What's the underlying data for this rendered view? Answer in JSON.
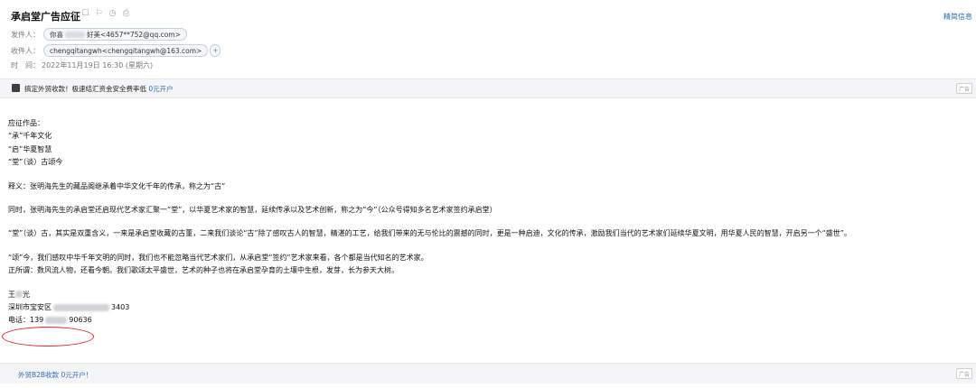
{
  "header": {
    "subject": "承启堂广告应征",
    "top_right_link": "精简信息",
    "sender_label": "发件人：",
    "sender_name_prefix": "你喜",
    "sender_name_suffix": "好美",
    "sender_email": "<4657**752@qq.com>",
    "recipient_label": "收件人：",
    "recipient": "chengqitangwh<chengqitangwh@163.com>",
    "time_label": "时　间：",
    "time_value": "2022年11月19日 16:30 (星期六)"
  },
  "top_ad": {
    "text": "搞定外贸收款！极速结汇资金安全费率低 ",
    "link": "0元开户",
    "tag": "广告"
  },
  "body": {
    "lines": [
      "应征作品：",
      "“承”千年文化",
      "“启”华夏智慧",
      "“堂”（谈）古颂今",
      "释义：张明海先生的藏品阁继承着中华文化千年的传承，称之为“古”",
      "同时，张明海先生的承启堂还启现代艺术家汇聚一“堂”，以华夏艺术家的智慧，延续传承以及艺术创新，称之为“今”（公众号得知多名艺术家签约承启堂）",
      "“堂”（谈）古，其实是双重含义，一来是承启堂收藏的古董，二来我们谈论“古”除了感叹古人的智慧，精湛的工艺，给我们带来的无与伦比的震撼的同时，更是一种启迪，文化的传承，激励我们当代的艺术家们延续华夏文明，用华夏人民的智慧，开启另一个“盛世”。",
      "“颂”今，我们感叹中华千年文明的同时，我们也不能忽略当代艺术家们，从承启堂“签约”艺术家来看，各个都是当代知名的艺术家。",
      "正所谓：数风流人物，还看今朝。我们歌颂太平盛世，艺术的种子也将在承启堂孕育的土壤中生根，发芽，长为参天大树。"
    ],
    "signature_name_prefix": "王",
    "signature_name_suffix": "光",
    "address_prefix": "深圳市宝安区",
    "address_suffix": "3403",
    "phone_label": "电话：",
    "phone_prefix": "139",
    "phone_suffix": "90636"
  },
  "bottom_ad": {
    "text": "外贸B2B收款 0元开户！",
    "tag": "广告"
  }
}
